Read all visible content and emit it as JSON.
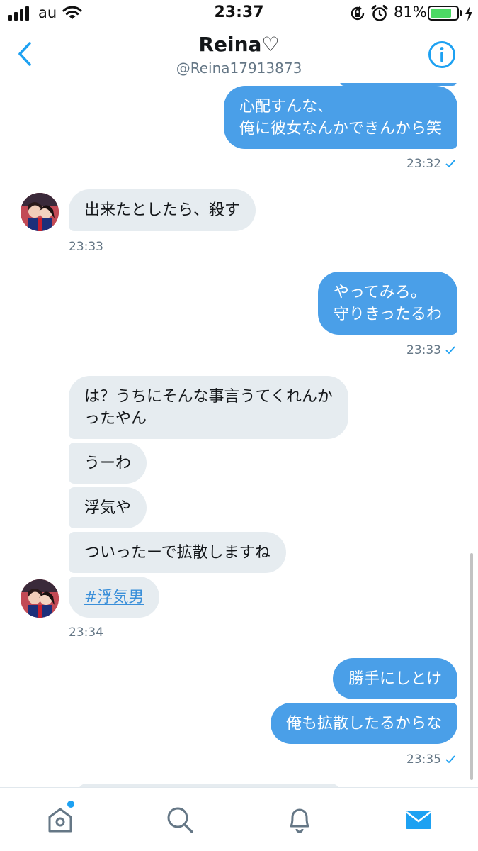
{
  "status_bar": {
    "carrier": "au",
    "time": "23:37",
    "battery_percent": "81%",
    "battery_level": 0.81,
    "icons": [
      "signal-icon",
      "wifi-icon",
      "orientation-lock-icon",
      "alarm-icon",
      "battery-icon",
      "charging-bolt-icon"
    ]
  },
  "header": {
    "name": "Reina♡",
    "handle": "@Reina17913873",
    "icons": [
      "back-icon",
      "info-icon"
    ]
  },
  "messages": [
    {
      "direction": "out",
      "text": "心配すんな、\n俺に彼女なんかできんから笑",
      "time": "23:32"
    },
    {
      "direction": "in",
      "text": "出来たとしたら、殺す",
      "time": "23:33"
    },
    {
      "direction": "out",
      "text": "やってみろ。\n守りきったるわ",
      "time": "23:33"
    },
    {
      "direction": "in",
      "text": "は？うちにそんな事言うてくれんか\nったやん"
    },
    {
      "direction": "in",
      "text": "うーわ"
    },
    {
      "direction": "in",
      "text": "浮気や"
    },
    {
      "direction": "in",
      "text": "ついったーで拡散しますね"
    },
    {
      "direction": "in",
      "text": "#浮気男",
      "time": "23:34"
    },
    {
      "direction": "out",
      "text": "勝手にしとけ"
    },
    {
      "direction": "out",
      "text": "俺も拡散したるからな",
      "time": "23:35"
    }
  ],
  "tab_bar": {
    "tabs": [
      "home-icon",
      "search-icon",
      "notifications-icon",
      "messages-icon"
    ],
    "active": "messages-icon",
    "colors": {
      "active": "#1da1f2",
      "inactive": "#657786"
    }
  },
  "colors": {
    "outgoing_bubble": "#4a9fe8",
    "incoming_bubble": "#e6ecf0",
    "accent": "#1da1f2"
  }
}
